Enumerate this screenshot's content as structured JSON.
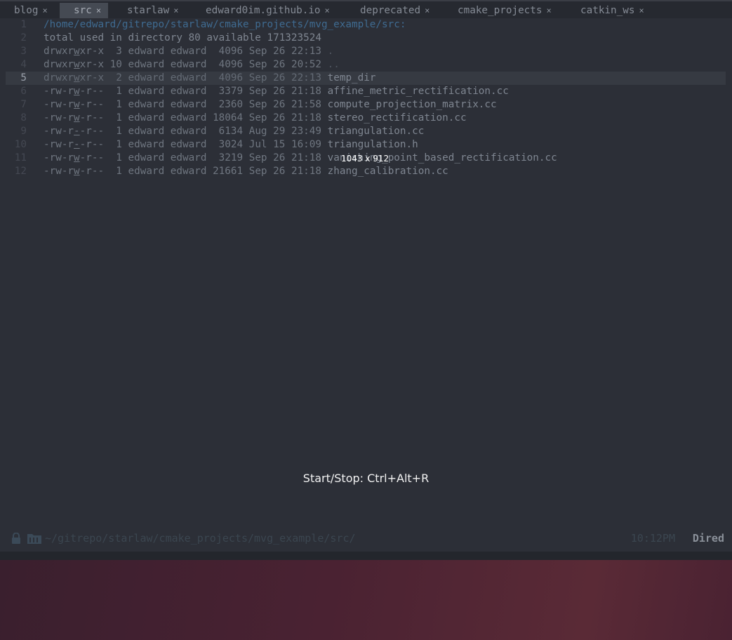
{
  "tabs": [
    {
      "label": "blog",
      "close": "×"
    },
    {
      "label": "src",
      "close": "×",
      "active": true
    },
    {
      "label": "starlaw",
      "close": "×"
    },
    {
      "label": "edward0im.github.io",
      "close": "×"
    },
    {
      "label": "deprecated",
      "close": "×"
    },
    {
      "label": "cmake_projects",
      "close": "×"
    },
    {
      "label": "catkin_ws",
      "close": "×"
    }
  ],
  "buffer": {
    "header": "/home/edward/gitrepo/starlaw/cmake_projects/mvg_example/src:",
    "total_line": "total used in directory 80 available 171323524",
    "current_line": 5,
    "entries": [
      {
        "perm_a": "drwxr",
        "perm_w": "w",
        "perm_b": "xr-x",
        "links": " 3",
        "owner": "edward",
        "group": "edward",
        "size": " 4096",
        "date": "Sep 26 22:13",
        "name": "."
      },
      {
        "perm_a": "drwxr",
        "perm_w": "w",
        "perm_b": "xr-x",
        "links": "10",
        "owner": "edward",
        "group": "edward",
        "size": " 4096",
        "date": "Sep 26 20:52",
        "name": ".."
      },
      {
        "perm_a": "drwxr",
        "perm_w": "w",
        "perm_b": "xr-x",
        "links": " 2",
        "owner": "edward",
        "group": "edward",
        "size": " 4096",
        "date": "Sep 26 22:13",
        "name": "temp_dir"
      },
      {
        "perm_a": "-rw-r",
        "perm_w": "w",
        "perm_b": "-r--",
        "links": " 1",
        "owner": "edward",
        "group": "edward",
        "size": " 3379",
        "date": "Sep 26 21:18",
        "name": "affine_metric_rectification.cc"
      },
      {
        "perm_a": "-rw-r",
        "perm_w": "w",
        "perm_b": "-r--",
        "links": " 1",
        "owner": "edward",
        "group": "edward",
        "size": " 2360",
        "date": "Sep 26 21:58",
        "name": "compute_projection_matrix.cc"
      },
      {
        "perm_a": "-rw-r",
        "perm_w": "w",
        "perm_b": "-r--",
        "links": " 1",
        "owner": "edward",
        "group": "edward",
        "size": "18064",
        "date": "Sep 26 21:18",
        "name": "stereo_rectification.cc"
      },
      {
        "perm_a": "-rw-r",
        "perm_w": "-",
        "perm_b": "-r--",
        "links": " 1",
        "owner": "edward",
        "group": "edward",
        "size": " 6134",
        "date": "Aug 29 23:49",
        "name": "triangulation.cc"
      },
      {
        "perm_a": "-rw-r",
        "perm_w": "-",
        "perm_b": "-r--",
        "links": " 1",
        "owner": "edward",
        "group": "edward",
        "size": " 3024",
        "date": "Jul 15 16:09",
        "name": "triangulation.h"
      },
      {
        "perm_a": "-rw-r",
        "perm_w": "w",
        "perm_b": "-r--",
        "links": " 1",
        "owner": "edward",
        "group": "edward",
        "size": " 3219",
        "date": "Sep 26 21:18",
        "name": "vanishing_point_based_rectification.cc"
      },
      {
        "perm_a": "-rw-r",
        "perm_w": "w",
        "perm_b": "-r--",
        "links": " 1",
        "owner": "edward",
        "group": "edward",
        "size": "21661",
        "date": "Sep 26 21:18",
        "name": "zhang_calibration.cc"
      }
    ]
  },
  "overlay": {
    "size_label": "1043 x 912",
    "hint": "Start/Stop: Ctrl+Alt+R"
  },
  "modeline": {
    "lock_icon": "lock-icon",
    "folder_icon": "folder-icon",
    "path": "~/gitrepo/starlaw/cmake_projects/mvg_example/src/",
    "time": "10:12PM",
    "mode": "Dired"
  },
  "colors": {
    "background": "#2c2f37",
    "tabbar": "#262930",
    "active_tab": "#454a53",
    "header_path": "#3f6b91",
    "current_line": "#363a42"
  }
}
